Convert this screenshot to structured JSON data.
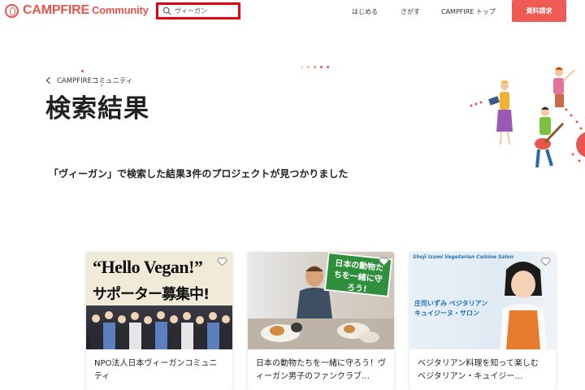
{
  "header": {
    "logo_text": "CAMPFIRE",
    "logo_sub": "Community",
    "search_value": "ヴィーガン",
    "nav": [
      "はじめる",
      "さがす",
      "CAMPFIRE トップ"
    ],
    "cta_label": "資料請求"
  },
  "hero": {
    "breadcrumb": "CAMPFIREコミュニティ",
    "title": "検索結果",
    "result_text": "「ヴィーガン」で検索した結果3件のプロジェクトが見つかりました"
  },
  "cards": [
    {
      "image_text_1": "“Hello Vegan!”",
      "image_text_2": "サポーター募集中!",
      "title": "NPO法人日本ヴィーガンコミュニティ"
    },
    {
      "image_badge": "日本の動物たちを一緒に守ろう!",
      "title": "日本の動物たちを一緒に守ろう！ヴィーガン男子のファンクラブ…"
    },
    {
      "image_text_1": "Shoji Izumi Vegetarian Cuisine Salon",
      "image_text_2": "庄司いずみ ベジタリアン",
      "image_text_3": "キュイジーヌ・サロン",
      "title": "ベジタリアン料理を知って楽しむ　ベジタリアン・キュイジー…"
    }
  ],
  "colors": {
    "brand": "#e8554d",
    "highlight_border": "#e60012",
    "cta": "#ef5a52"
  }
}
